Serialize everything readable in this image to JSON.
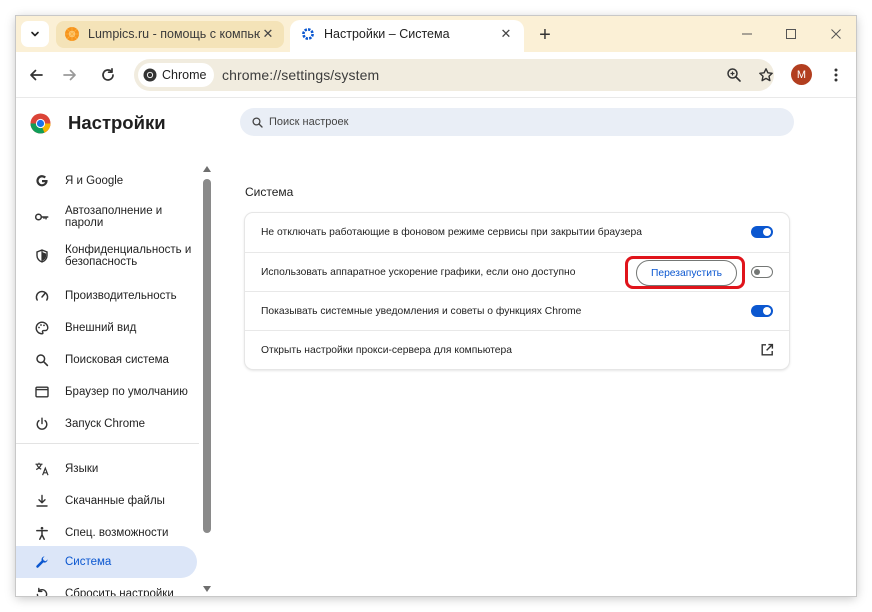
{
  "tabs": [
    {
      "title": "Lumpics.ru - помощь с компьютером",
      "icon": "orange-favicon-icon",
      "active": false
    },
    {
      "title": "Настройки – Система",
      "icon": "gear-icon",
      "active": true
    }
  ],
  "toolbar": {
    "chip_label": "Chrome",
    "url": "chrome://settings/system",
    "avatar_letter": "M"
  },
  "settings": {
    "title": "Настройки",
    "search_placeholder": "Поиск настроек",
    "nav": [
      {
        "label": "Я и Google",
        "icon": "google-g-icon"
      },
      {
        "label": "Автозаполнение и пароли",
        "icon": "key-icon"
      },
      {
        "label": "Конфиденциальность и безопасность",
        "icon": "shield-icon"
      },
      {
        "label": "Производительность",
        "icon": "speedometer-icon"
      },
      {
        "label": "Внешний вид",
        "icon": "palette-icon"
      },
      {
        "label": "Поисковая система",
        "icon": "search-icon"
      },
      {
        "label": "Браузер по умолчанию",
        "icon": "browser-window-icon"
      },
      {
        "label": "Запуск Chrome",
        "icon": "power-icon"
      },
      {
        "label": "Языки",
        "icon": "translate-icon"
      },
      {
        "label": "Скачанные файлы",
        "icon": "download-icon"
      },
      {
        "label": "Спец. возможности",
        "icon": "accessibility-icon"
      },
      {
        "label": "Система",
        "icon": "wrench-icon",
        "active": true
      },
      {
        "label": "Сбросить настройки",
        "icon": "reset-icon"
      }
    ],
    "section_title": "Система",
    "rows": [
      {
        "label": "Не отключать работающие в фоновом режиме сервисы при закрытии браузера",
        "control": "toggle",
        "on": true
      },
      {
        "label": "Использовать аппаратное ускорение графики, если оно доступно",
        "control": "toggle",
        "on": false,
        "button": "Перезапустить"
      },
      {
        "label": "Показывать системные уведомления и советы о функциях Chrome",
        "control": "toggle",
        "on": true
      },
      {
        "label": "Открыть настройки прокси-сервера для компьютера",
        "control": "external-link"
      }
    ]
  },
  "colors": {
    "accent": "#0b57d0",
    "tabstrip": "#fbf0d6",
    "highlight": "#e0141b",
    "active_nav_bg": "#dce6f8"
  }
}
